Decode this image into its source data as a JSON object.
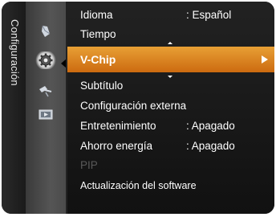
{
  "sidebar": {
    "title": "Configuración",
    "icons": [
      {
        "name": "picture-icon",
        "selected": false
      },
      {
        "name": "setup-gear-icon",
        "selected": true
      },
      {
        "name": "satellite-antenna-icon",
        "selected": false
      },
      {
        "name": "input-source-icon",
        "selected": false
      }
    ]
  },
  "menu": {
    "items": [
      {
        "label": "Idioma",
        "value": ": Español",
        "enabled": true
      },
      {
        "label": "Tiempo",
        "value": "",
        "enabled": true
      },
      {
        "label": "Subtítulo",
        "value": "",
        "enabled": true
      },
      {
        "label": "Configuración externa",
        "value": "",
        "enabled": true
      },
      {
        "label": "Entretenimiento",
        "value": ": Apagado",
        "enabled": true
      },
      {
        "label": "Ahorro energía",
        "value": ": Apagado",
        "enabled": true
      },
      {
        "label": "PIP",
        "value": "",
        "enabled": false
      },
      {
        "label": "Actualización del software",
        "value": "",
        "enabled": true
      }
    ],
    "selected": {
      "label": "V-Chip",
      "has_submenu": true
    }
  },
  "colors": {
    "highlight_top": "#e8a035",
    "highlight_bottom": "#cc6a10",
    "disabled_text": "#5a5a5a"
  }
}
